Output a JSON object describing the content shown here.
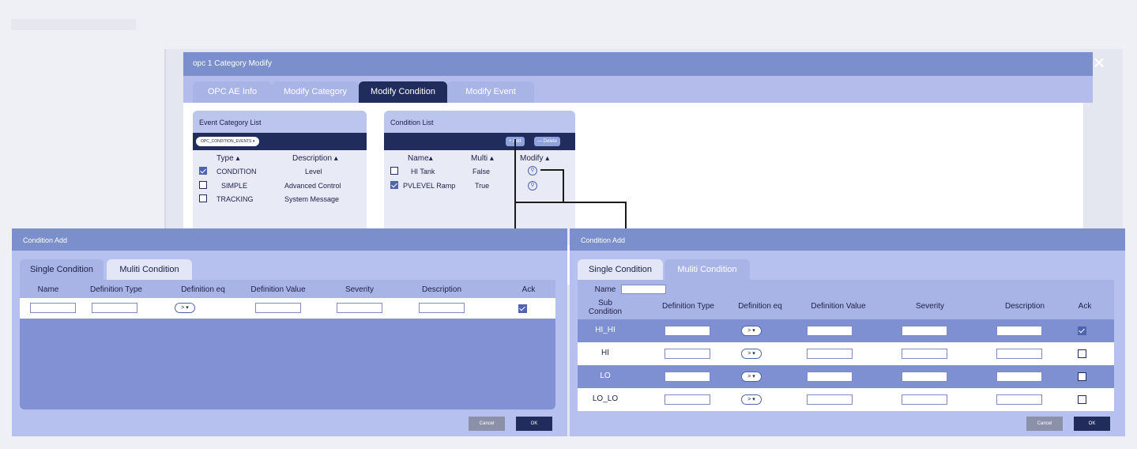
{
  "main": {
    "title": "opc 1 Category Modify",
    "close_glyph": "×",
    "tabs": [
      {
        "label": "OPC AE Info"
      },
      {
        "label": "Modify Category"
      },
      {
        "label": "Modify Condition",
        "active": true
      },
      {
        "label": "Modify Event"
      }
    ],
    "event_category": {
      "title": "Event Category List",
      "filter": "OPC_CONDITION_EVENTS",
      "headers": [
        "Type",
        "Description"
      ],
      "rows": [
        {
          "type": "CONDITION",
          "description": "Level",
          "checked": true
        },
        {
          "type": "SIMPLE",
          "description": "Advanced Control",
          "checked": false
        },
        {
          "type": "TRACKING",
          "description": "System Message",
          "checked": false
        }
      ]
    },
    "condition_list": {
      "title": "Condition List",
      "add_label": "+ Add",
      "delete_label": "— Delete",
      "headers": [
        "Name",
        "Multi",
        "Modify"
      ],
      "rows": [
        {
          "name": "HI Tank",
          "multi": "False",
          "checked": false
        },
        {
          "name": "PVLEVEL Ramp",
          "multi": "True",
          "checked": true
        }
      ]
    }
  },
  "left_dialog": {
    "title": "Condition Add",
    "tabs": [
      "Single Condition",
      "Muliti Condition"
    ],
    "headers": [
      "Name",
      "Definition Type",
      "Definition eq",
      "Definition Value",
      "Severity",
      "Description",
      "Ack"
    ],
    "eq_value": "> ▾",
    "ack_checked": true,
    "cancel_label": "Cancel",
    "ok_label": "OK"
  },
  "right_dialog": {
    "title": "Condition Add",
    "tabs": [
      "Single Condition",
      "Muliti Condition"
    ],
    "name_label": "Name",
    "headers": [
      "Sub Condition",
      "Definition Type",
      "Definition eq",
      "Definition Value",
      "Severity",
      "Description",
      "Ack"
    ],
    "eq_value": "> ▾",
    "rows": [
      {
        "sub": "HI_HI",
        "ack": true
      },
      {
        "sub": "HI",
        "ack": false
      },
      {
        "sub": "LO",
        "ack": false
      },
      {
        "sub": "LO_LO",
        "ack": false
      }
    ],
    "cancel_label": "Cancel",
    "ok_label": "OK"
  }
}
